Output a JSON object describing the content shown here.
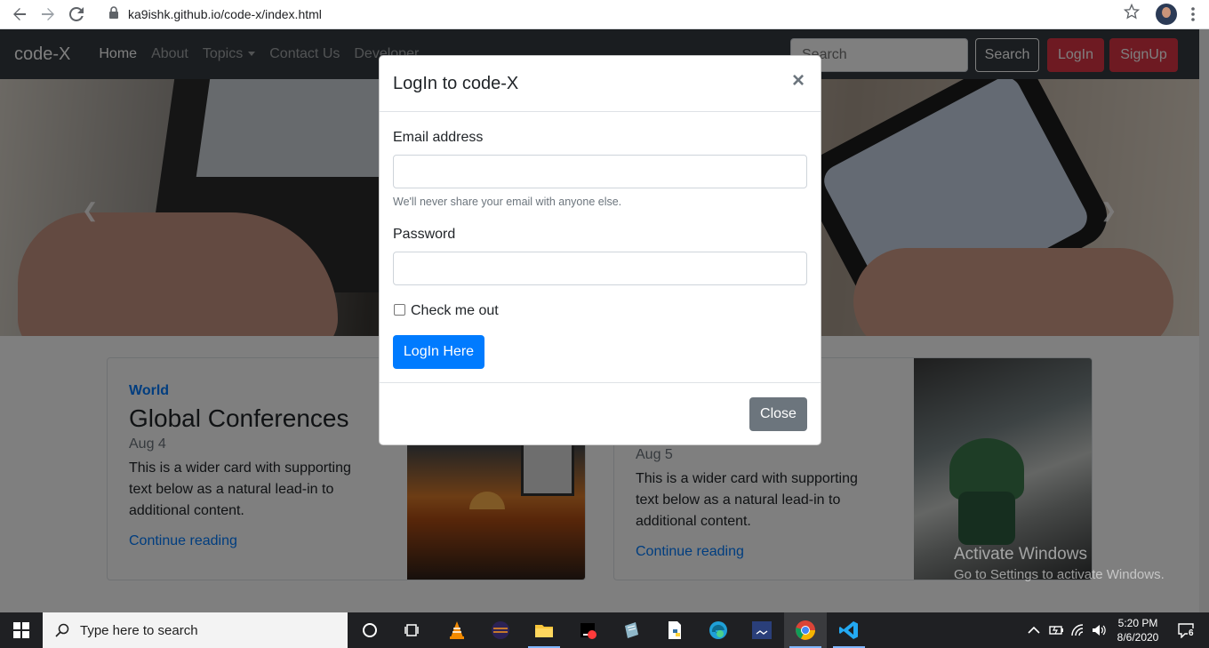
{
  "browser": {
    "url": "ka9ishk.github.io/code-x/index.html"
  },
  "site": {
    "brand": "code-X",
    "nav": [
      "Home",
      "About",
      "Topics",
      "Contact Us",
      "Developer"
    ],
    "search_placeholder": "Search",
    "search_button": "Search",
    "login_button": "LogIn",
    "signup_button": "SignUp"
  },
  "cards": [
    {
      "category": "World",
      "title": "Global Conferences",
      "date": "Aug 4",
      "text": "This is a wider card with supporting text below as a natural lead-in to additional content.",
      "link": "Continue reading"
    },
    {
      "date": "Aug 5",
      "text": "This is a wider card with supporting text below as a natural lead-in to additional content.",
      "link": "Continue reading"
    }
  ],
  "modal": {
    "title": "LogIn to code-X",
    "close_glyph": "×",
    "email_label": "Email address",
    "email_value": "",
    "email_help": "We'll never share your email with anyone else.",
    "password_label": "Password",
    "password_value": "",
    "checkbox_label": "Check me out",
    "submit_label": "LogIn Here",
    "close_label": "Close"
  },
  "watermark": {
    "title": "Activate Windows",
    "subtitle": "Go to Settings to activate Windows."
  },
  "taskbar": {
    "search_placeholder": "Type here to search",
    "time": "5:20 PM",
    "date": "8/6/2020",
    "notification_count": "6"
  },
  "colors": {
    "navbar": "#343a40",
    "primary": "#007bff",
    "danger": "#dc3545",
    "secondary": "#6c757d"
  }
}
